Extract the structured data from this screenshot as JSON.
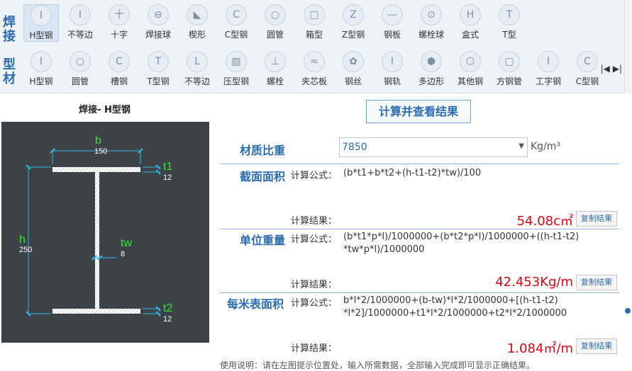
{
  "toolbar": {
    "row1_label": "焊接",
    "row2_label": "型材",
    "row1_items": [
      "H型钢",
      "不等边",
      "十字",
      "焊接球",
      "楔形",
      "C型钢",
      "圆管",
      "箱型",
      "Z型钢",
      "钢板",
      "螺栓球",
      "盒式",
      "T型"
    ],
    "row2_items": [
      "H型钢",
      "圆管",
      "槽钢",
      "T型钢",
      "不等边",
      "压型钢",
      "螺栓",
      "夹芯板",
      "钢丝",
      "钢轨",
      "多边形",
      "其他钢",
      "方钢管",
      "工字钢",
      "C型钢"
    ],
    "scroll_arrows": "|◀ ▶|"
  },
  "diagram": {
    "title": "焊接- H型钢",
    "b_label": "b",
    "b_value": "150",
    "t1_label": "t1",
    "t1_value": "12",
    "h_label": "h",
    "h_value": "250",
    "tw_label": "tw",
    "tw_value": "8",
    "t2_label": "t2",
    "t2_value": "12"
  },
  "calc_button": "计算并查看结果",
  "density": {
    "label": "材质比重",
    "value": "7850",
    "unit": "Kg/m³"
  },
  "sections": [
    {
      "label": "截面面积",
      "formula_label": "计算公式：",
      "formula_line1": "(b*t1+b*t2+(h-t1-t2)*tw)/100",
      "formula_line2": "",
      "result_label": "计算结果：",
      "result": "54.08c㎡",
      "copy": "复制结果"
    },
    {
      "label": "单位重量",
      "formula_label": "计算公式：",
      "formula_line1": "(b*t1*p*l)/1000000+(b*t2*p*l)/1000000+((h-t1-t2)",
      "formula_line2": "*tw*p*l)/1000000",
      "result_label": "计算结果：",
      "result": "42.453Kg/m",
      "copy": "复制结果"
    },
    {
      "label": "每米表面积",
      "formula_label": "计算公式：",
      "formula_line1": "b*l*2/1000000+(b-tw)*l*2/1000000+[(h-t1-t2)",
      "formula_line2": "*l*2]/1000000+t1*l*2/1000000+t2*l*2/1000000",
      "result_label": "计算结果：",
      "result": "1.084㎡/m",
      "copy": "复制结果"
    }
  ],
  "footer_note": "使用说明：请在左图提示位置处，输入所需数据，全部输入完成即可显示正确结果。"
}
